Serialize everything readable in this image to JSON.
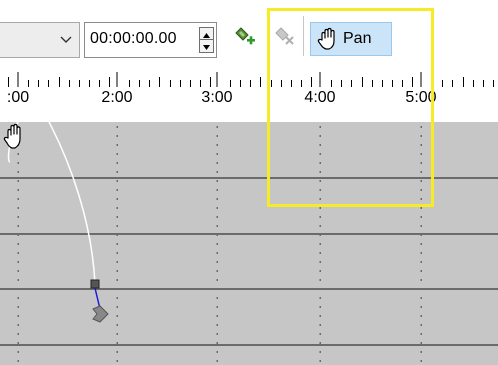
{
  "toolbar": {
    "dropdown_icon": "chevron-down-icon",
    "time_value": "00:00:00.00",
    "spinner_icon": "spin-up-down-icon",
    "add_keyframe_icon": "add-keyframe-icon",
    "remove_keyframe_icon": "remove-keyframe-icon",
    "pan_icon": "hand-icon",
    "pan_label": "Pan"
  },
  "ruler": {
    "labels": [
      ":00",
      "2:00",
      "3:00",
      "4:00",
      "5:00"
    ]
  },
  "canvas": {
    "cursor_icon": "hand-cursor-icon"
  },
  "colors": {
    "accent_highlight": "#f5ec25",
    "pan_active_bg": "#cce4f7",
    "graph_bg": "#c6c6c6",
    "keyframe_line": "#1b1bd8"
  }
}
